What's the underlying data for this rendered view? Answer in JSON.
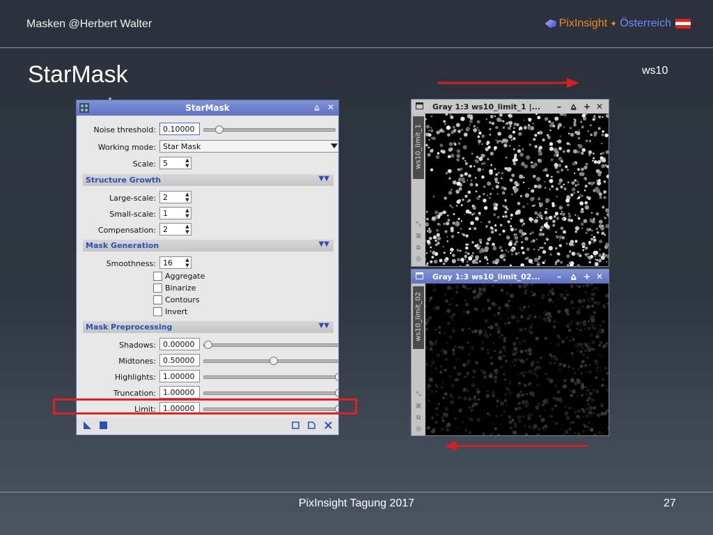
{
  "header": {
    "left": "Masken  @Herbert Walter",
    "brand_pi": "PixInsight",
    "brand_at": "Österreich"
  },
  "slide": {
    "title": "StarMask",
    "corner_label": "ws10",
    "footer": "PixInsight Tagung 2017",
    "page": "27"
  },
  "dialog": {
    "title": "StarMask",
    "noise_threshold": {
      "label": "Noise threshold:",
      "value": "0.10000",
      "slider": 0.09
    },
    "working_mode": {
      "label": "Working mode:",
      "value": "Star Mask"
    },
    "scale": {
      "label": "Scale:",
      "value": "5"
    },
    "structure_growth": {
      "title": "Structure Growth",
      "large": {
        "label": "Large-scale:",
        "value": "2"
      },
      "small": {
        "label": "Small-scale:",
        "value": "1"
      },
      "compensation": {
        "label": "Compensation:",
        "value": "2"
      }
    },
    "mask_generation": {
      "title": "Mask Generation",
      "smoothness": {
        "label": "Smoothness:",
        "value": "16"
      },
      "checkboxes": [
        "Aggregate",
        "Binarize",
        "Contours",
        "Invert"
      ]
    },
    "mask_preprocessing": {
      "title": "Mask Preprocessing",
      "shadows": {
        "label": "Shadows:",
        "value": "0.00000",
        "slider": 0.0
      },
      "midtones": {
        "label": "Midtones:",
        "value": "0.50000",
        "slider": 0.5
      },
      "highlights": {
        "label": "Highlights:",
        "value": "1.00000",
        "slider": 1.0
      },
      "truncation": {
        "label": "Truncation:",
        "value": "1.00000",
        "slider": 1.0
      },
      "limit": {
        "label": "Limit:",
        "value": "1.00000",
        "slider": 1.0
      }
    }
  },
  "preview1": {
    "title": "Gray 1:3 ws10_limit_1 |...",
    "side": "ws10_limit_1"
  },
  "preview2": {
    "title": "Gray 1:3 ws10_limit_02...",
    "side": "ws10_limit_02"
  },
  "colors": {
    "highlight": "#e02020",
    "accent": "#5f72c2",
    "section_text": "#2a4fb6"
  }
}
